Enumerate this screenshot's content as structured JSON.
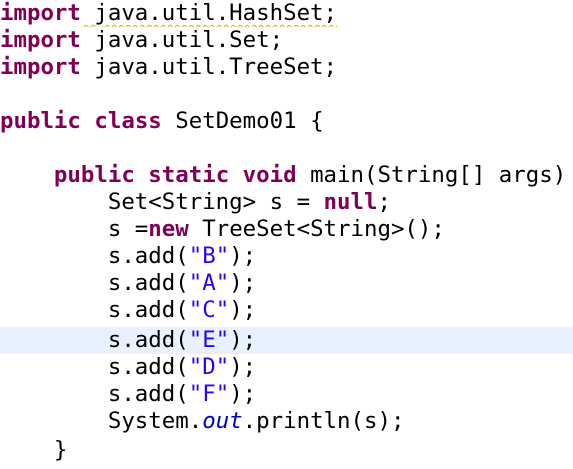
{
  "editor": {
    "language": "java",
    "current_line_highlight_color": "#e8f2fe",
    "colors": {
      "keyword": "#7f0055",
      "string": "#2a00ff",
      "static_field": "#0000c0",
      "text": "#000000"
    },
    "lines": [
      {
        "kw": "import",
        "rest": " java.util.HashSet;"
      },
      {
        "kw": "import",
        "rest": " java.util.Set;"
      },
      {
        "kw": "import",
        "rest": " java.util.TreeSet;"
      },
      {
        "text": ""
      },
      {
        "kw1": "public",
        "kw2": "class",
        "rest": " SetDemo01 {"
      },
      {
        "text": ""
      },
      {
        "indent": "    ",
        "kw1": "public",
        "kw2": "static",
        "kw3": "void",
        "rest": " main(String[] args) {"
      },
      {
        "pre": "        Set<String> s = ",
        "kw": "null",
        "post": ";"
      },
      {
        "pre": "        s =",
        "kw": "new",
        "post": " TreeSet<String>();"
      },
      {
        "pre": "        s.add(",
        "str": "\"B\"",
        "post": ");"
      },
      {
        "pre": "        s.add(",
        "str": "\"A\"",
        "post": ");"
      },
      {
        "pre": "        s.add(",
        "str": "\"C\"",
        "post": ");"
      },
      {
        "pre": "        s.add(",
        "str": "\"E\"",
        "post": ");"
      },
      {
        "pre": "        s.add(",
        "str": "\"D\"",
        "post": ");"
      },
      {
        "pre": "        s.add(",
        "str": "\"F\"",
        "post": ");"
      },
      {
        "pre": "        System.",
        "field": "out",
        "post": ".println(s);"
      },
      {
        "text": "    }"
      }
    ]
  }
}
